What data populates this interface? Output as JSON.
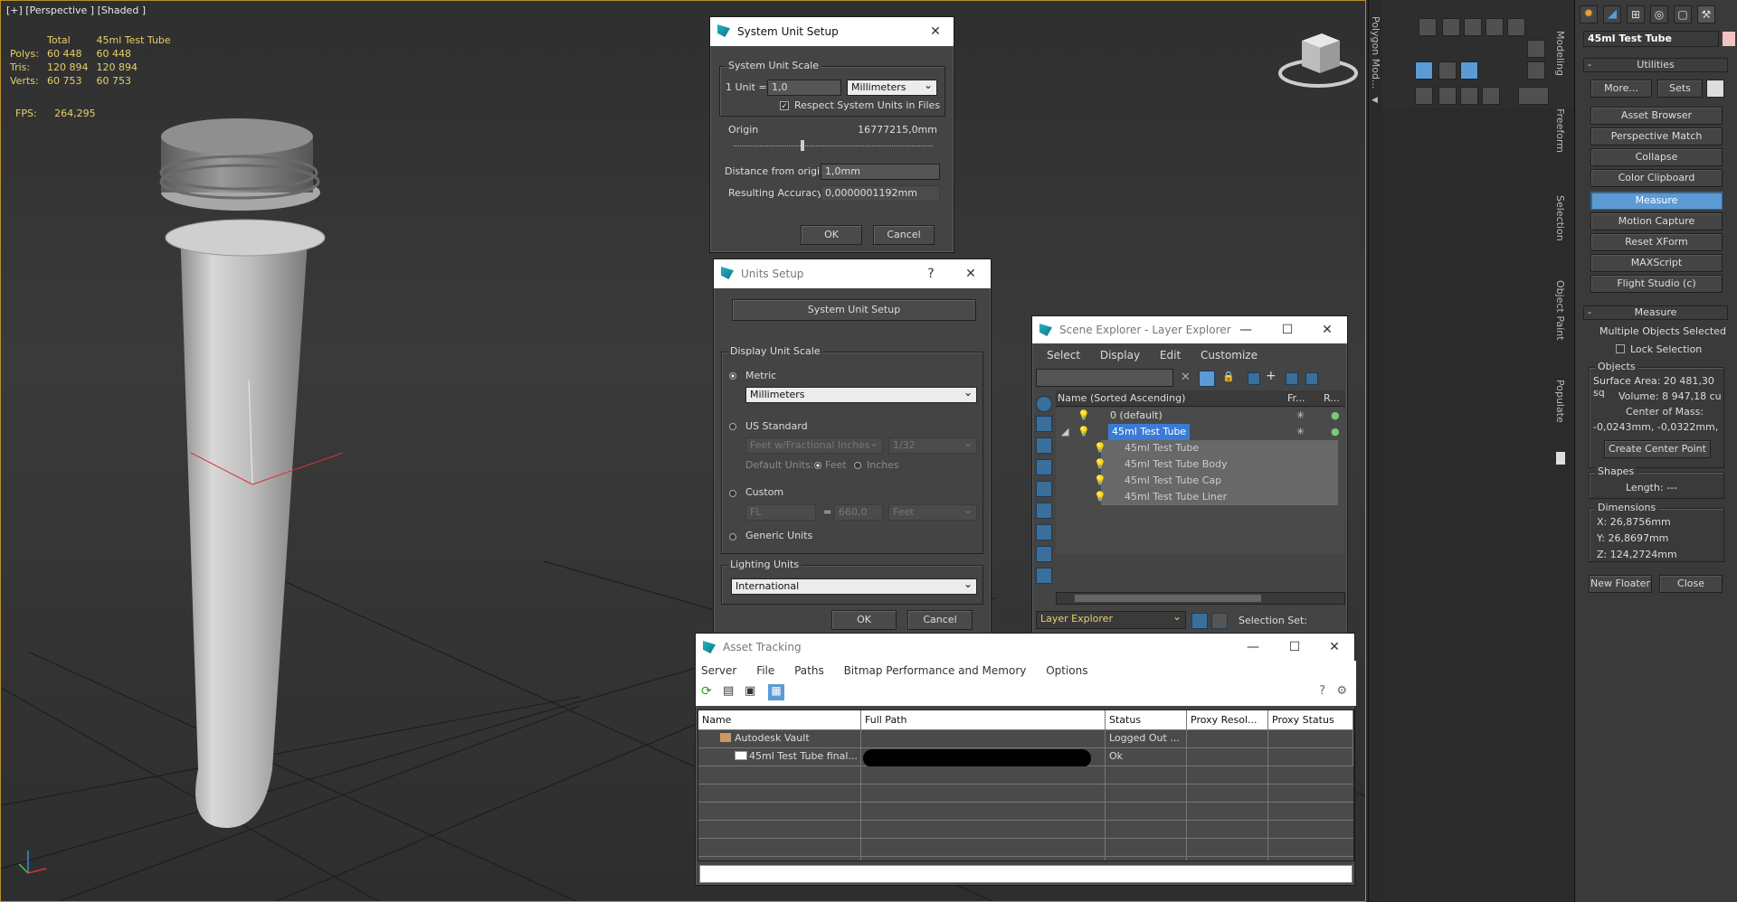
{
  "viewport": {
    "label": "[+] [Perspective ] [Shaded ]",
    "stats": {
      "header_total": "Total",
      "header_object": "45ml Test Tube",
      "rows": [
        {
          "label": "Polys:",
          "total": "60 448",
          "object": "60 448"
        },
        {
          "label": "Tris:",
          "total": "120 894",
          "object": "120 894"
        },
        {
          "label": "Verts:",
          "total": "60 753",
          "object": "60 753"
        }
      ]
    },
    "fps_label": "FPS:",
    "fps_value": "264,295"
  },
  "system_unit_setup": {
    "title": "System Unit Setup",
    "scale_group": "System Unit Scale",
    "unit_prefix": "1 Unit =",
    "unit_value": "1,0",
    "unit_type": "Millimeters",
    "respect_label": "Respect System Units in Files",
    "origin_label": "Origin",
    "origin_value": "16777215,0mm",
    "distance_label": "Distance from origin:",
    "distance_value": "1,0mm",
    "accuracy_label": "Resulting Accuracy:",
    "accuracy_value": "0,0000001192mm",
    "ok": "OK",
    "cancel": "Cancel"
  },
  "units_setup": {
    "title": "Units Setup",
    "help": "?",
    "system_button": "System Unit Setup",
    "display_group": "Display Unit Scale",
    "metric": "Metric",
    "metric_value": "Millimeters",
    "us_standard": "US Standard",
    "us_value": "Feet w/Fractional Inches",
    "us_fraction": "1/32",
    "default_units": "Default Units:",
    "feet": "Feet",
    "inches": "Inches",
    "custom": "Custom",
    "custom_name": "FL",
    "custom_eq": "=",
    "custom_value": "660,0",
    "custom_unit": "Feet",
    "generic": "Generic Units",
    "lighting_group": "Lighting Units",
    "lighting_value": "International",
    "ok": "OK",
    "cancel": "Cancel"
  },
  "scene_explorer": {
    "title": "Scene Explorer - Layer Explorer",
    "menu": [
      "Select",
      "Display",
      "Edit",
      "Customize"
    ],
    "col_name": "Name (Sorted Ascending)",
    "col_fr": "Fr...",
    "col_r": "R...",
    "rows": [
      {
        "name": "0 (default)",
        "indent": 0
      },
      {
        "name": "45ml Test Tube",
        "indent": 0
      },
      {
        "name": "45ml Test Tube",
        "indent": 1
      },
      {
        "name": "45ml Test Tube Body",
        "indent": 1
      },
      {
        "name": "45ml Test Tube Cap",
        "indent": 1
      },
      {
        "name": "45ml Test Tube Liner",
        "indent": 1
      }
    ],
    "explorer_select": "Layer Explorer",
    "selection_set": "Selection Set:"
  },
  "asset_tracking": {
    "title": "Asset Tracking",
    "menu": [
      "Server",
      "File",
      "Paths",
      "Bitmap Performance and Memory",
      "Options"
    ],
    "columns": [
      "Name",
      "Full Path",
      "Status",
      "Proxy Resol...",
      "Proxy Status"
    ],
    "rows": [
      {
        "name": "Autodesk Vault",
        "path": "",
        "status": "Logged Out ..."
      },
      {
        "name": "45ml Test Tube final...",
        "path": "",
        "status": "Ok"
      }
    ]
  },
  "side_tabs": [
    "Polygon Mod...",
    "Modeling",
    "Freeform",
    "Selection",
    "Object Paint",
    "Populate"
  ],
  "command_panel": {
    "object_name": "45ml Test Tube",
    "utilities_title": "Utilities",
    "more": "More...",
    "sets": "Sets",
    "buttons": [
      "Asset Browser",
      "Perspective Match",
      "Collapse",
      "Color Clipboard",
      "Measure",
      "Motion Capture",
      "Reset XForm",
      "MAXScript",
      "Flight Studio (c)"
    ],
    "measure_title": "Measure",
    "multiple_selected": "Multiple Objects Selected",
    "lock_selection": "Lock Selection",
    "objects_group": "Objects",
    "surface_area": "Surface Area: 20 481,30 sq",
    "volume": "Volume: 8 947,18 cu",
    "center_mass": "Center of Mass:",
    "center_mass_value": "-0,0243mm, -0,0322mm,",
    "create_center": "Create Center Point",
    "shapes_group": "Shapes",
    "length": "Length: ---",
    "dimensions_group": "Dimensions",
    "dim_x": "X:  26,8756mm",
    "dim_y": "Y:  26,8697mm",
    "dim_z": "Z:  124,2724mm",
    "new_floater": "New Floater",
    "close": "Close"
  },
  "colors": {
    "accent_blue": "#5b9bd5",
    "stats_yellow": "#e7d06a",
    "viewport_border": "#b49228",
    "selection_blue": "#3a7bd5"
  }
}
